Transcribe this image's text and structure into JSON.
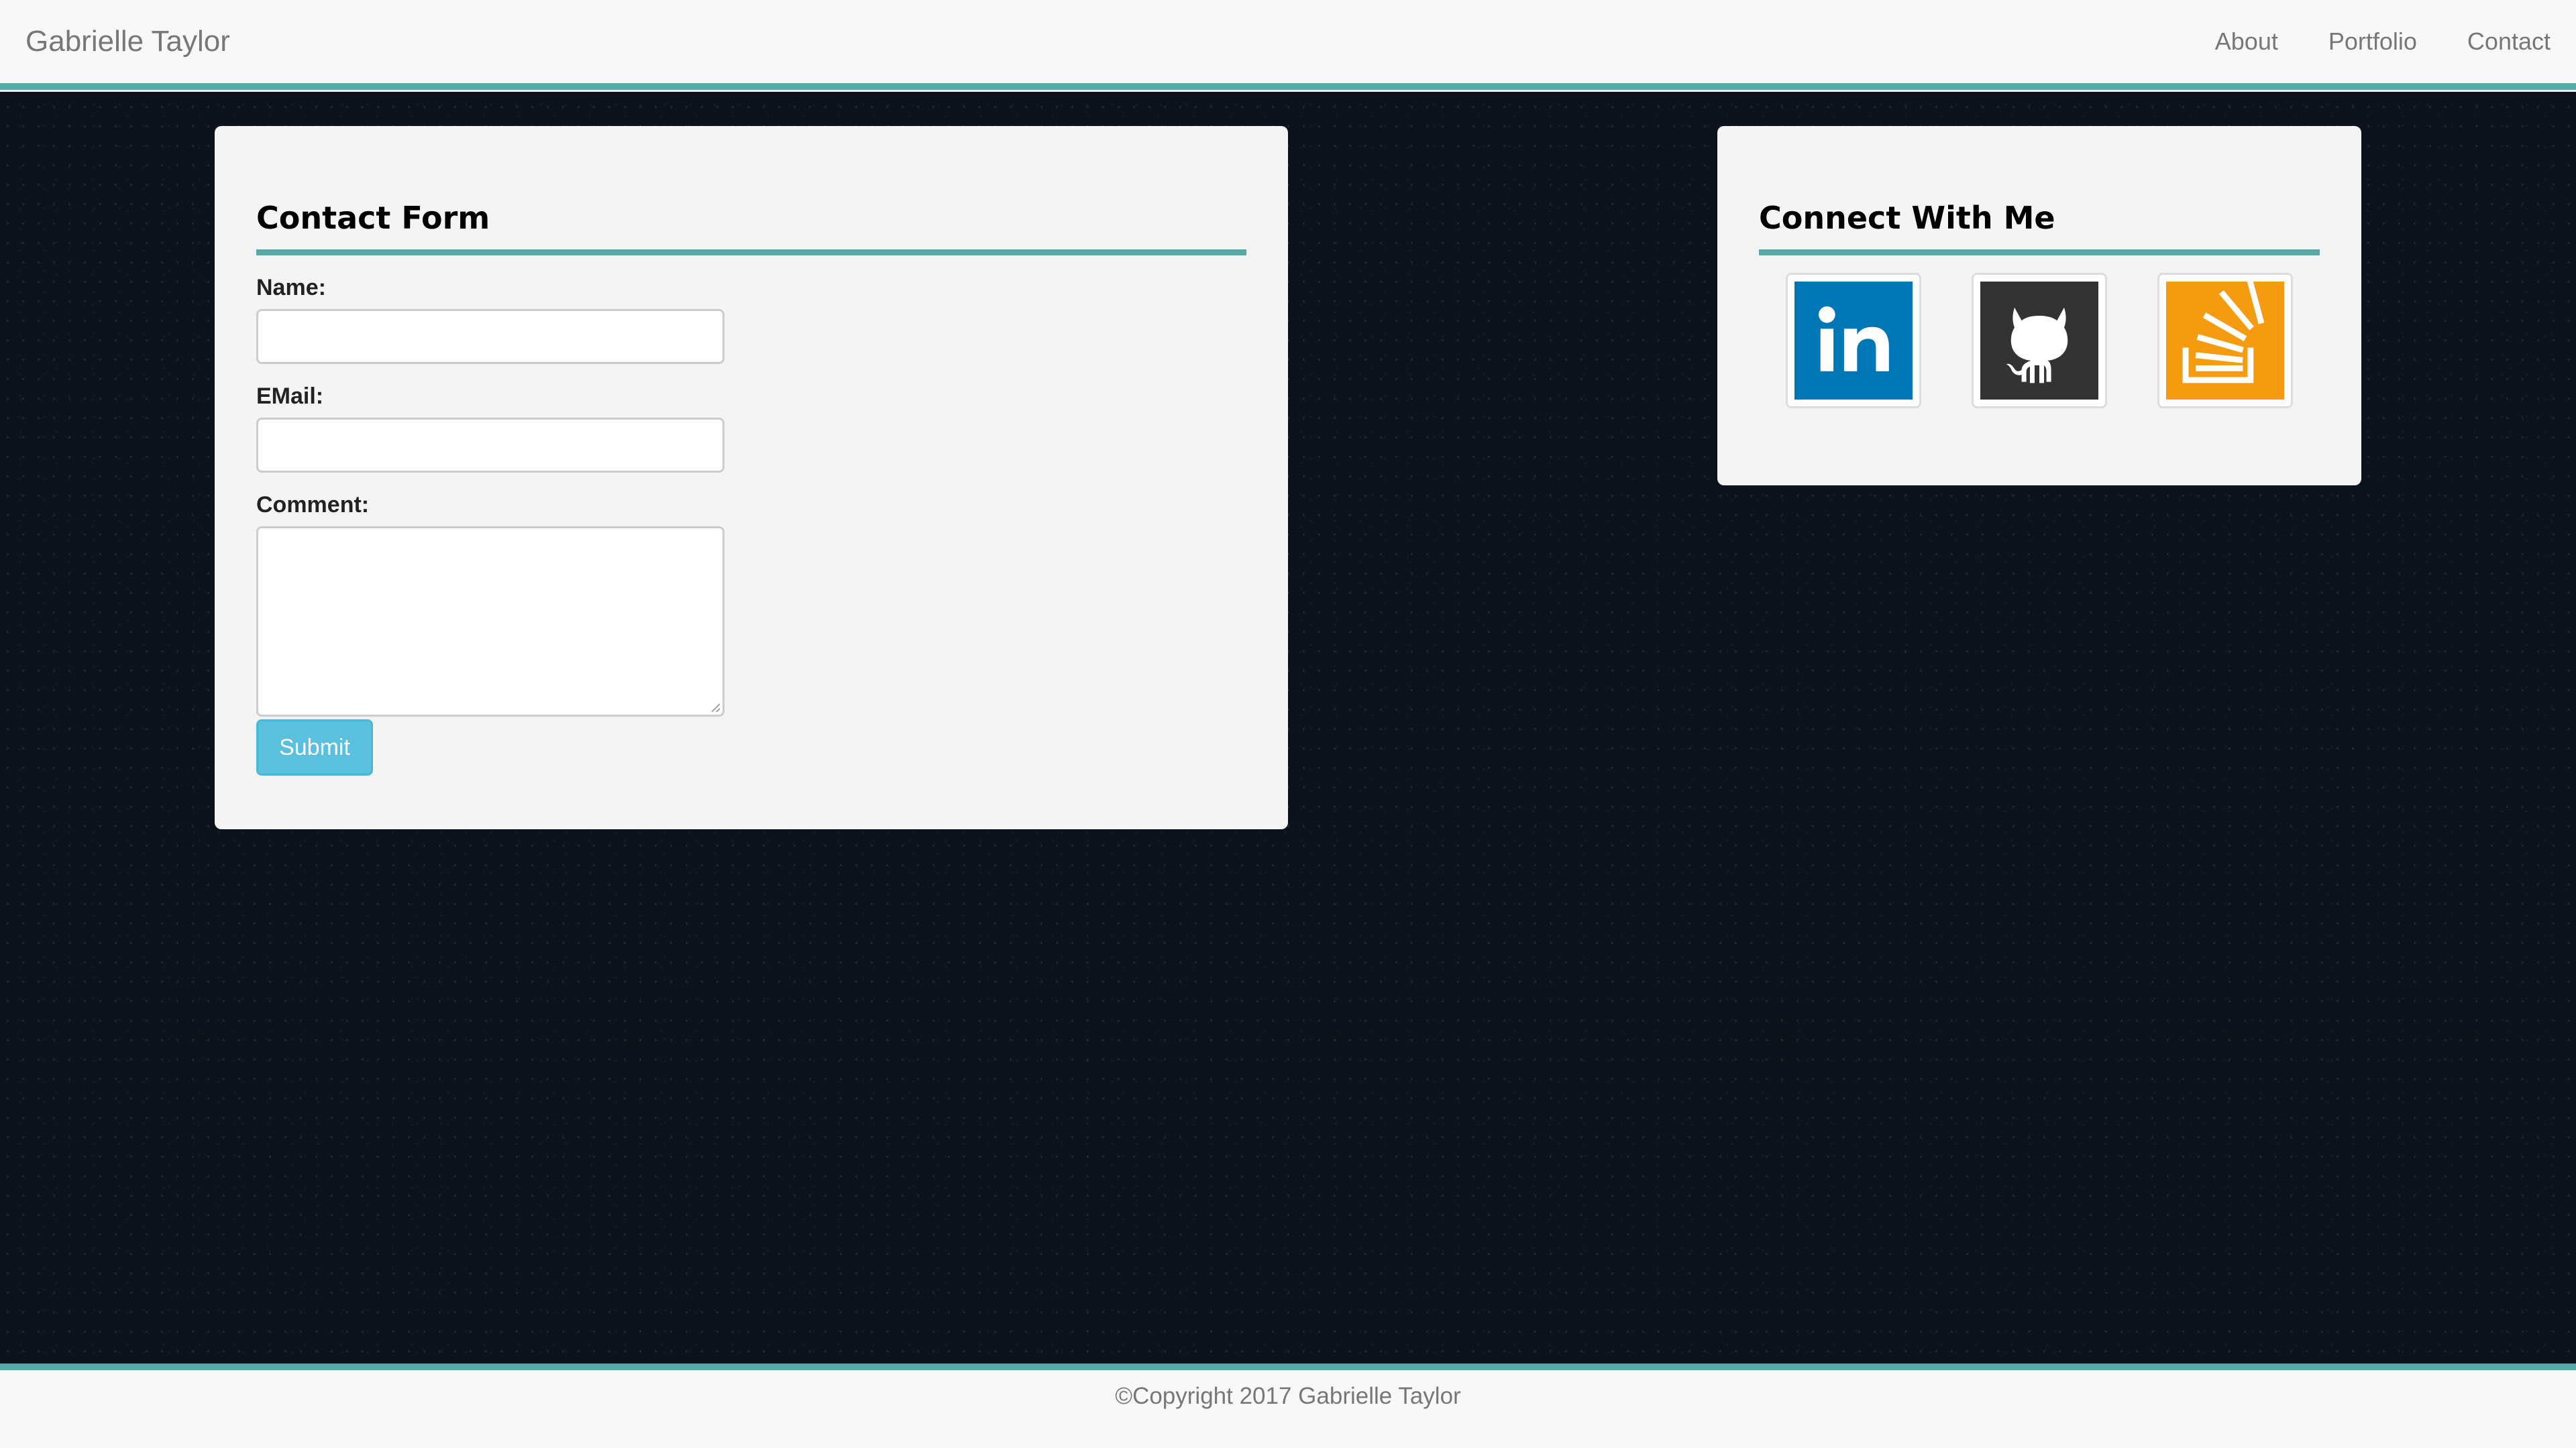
{
  "navbar": {
    "brand": "Gabrielle Taylor",
    "links": [
      "About",
      "Portfolio",
      "Contact"
    ]
  },
  "contact_form": {
    "title": "Contact Form",
    "name_label": "Name:",
    "name_value": "",
    "email_label": "EMail:",
    "email_value": "",
    "comment_label": "Comment:",
    "comment_value": "",
    "submit_label": "Submit"
  },
  "connect": {
    "title": "Connect With Me",
    "links": [
      {
        "name": "linkedin-icon",
        "color": "#0077b5"
      },
      {
        "name": "github-icon",
        "color": "#333333"
      },
      {
        "name": "stackoverflow-icon",
        "color": "#f48024"
      }
    ]
  },
  "footer": {
    "copyright": "©Copyright 2017 Gabrielle Taylor"
  },
  "colors": {
    "accent": "#55aaa8",
    "button": "#5bc0de",
    "background": "#0d121b",
    "panel": "#f4f4f4"
  }
}
